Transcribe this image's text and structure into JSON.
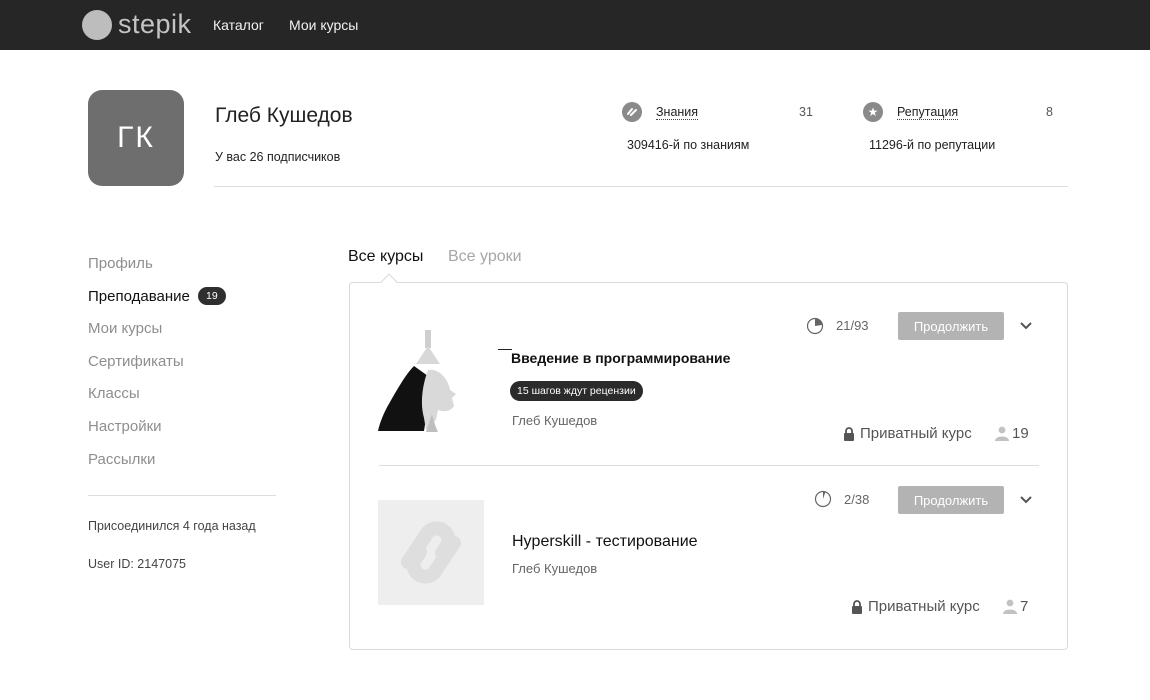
{
  "topbar": {
    "logo_text": "stepik",
    "nav": [
      "Каталог",
      "Мои курсы"
    ]
  },
  "profile": {
    "initials": "ГК",
    "name": "Глеб Кушедов",
    "subscribers": "У вас 26 подписчиков",
    "knowledge": {
      "label": "Знания",
      "value": "31",
      "rank": "309416-й по знаниям",
      "icon": "knowledge-icon"
    },
    "reputation": {
      "label": "Репутация",
      "value": "8",
      "rank": "11296-й по репутации",
      "icon": "star-icon"
    }
  },
  "sidebar": {
    "items": [
      {
        "label": "Профиль",
        "active": false
      },
      {
        "label": "Преподавание",
        "active": true,
        "badge": "19"
      },
      {
        "label": "Мои курсы",
        "active": false
      },
      {
        "label": "Сертификаты",
        "active": false
      },
      {
        "label": "Классы",
        "active": false
      },
      {
        "label": "Настройки",
        "active": false
      },
      {
        "label": "Рассылки",
        "active": false
      }
    ],
    "joined": "Присоединился 4 года назад",
    "user_id": "User ID: 2147075"
  },
  "tabs": {
    "all_courses": "Все курсы",
    "all_lessons": "Все уроки"
  },
  "courses": [
    {
      "title": "Введение в программирование",
      "author": "Глеб Кушедов",
      "review_badge": "15 шагов ждут рецензии",
      "progress": "21/93",
      "progress_fraction": 0.226,
      "continue_label": "Продолжить",
      "private_label": "Приватный курс",
      "learners": "19"
    },
    {
      "title": "Hyperskill - тестирование",
      "author": "Глеб Кушедов",
      "progress": "2/38",
      "progress_fraction": 0.053,
      "continue_label": "Продолжить",
      "private_label": "Приватный курс",
      "learners": "7"
    }
  ],
  "colors": {
    "topbar": "#262626",
    "avatar": "#6e6e6e",
    "button": "#b3b3b3",
    "badge": "#2f2f2f"
  }
}
